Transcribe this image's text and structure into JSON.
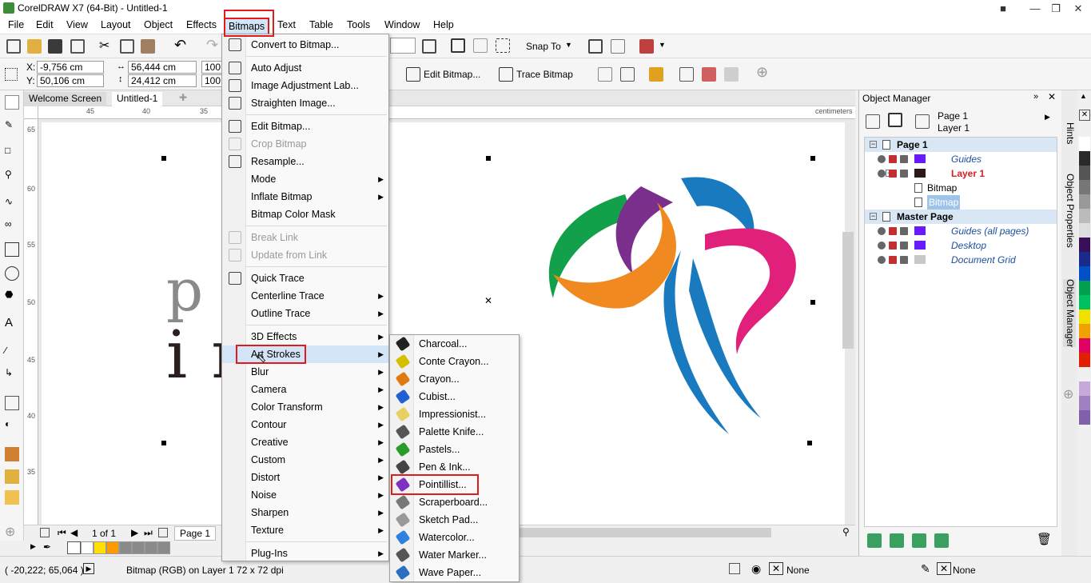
{
  "window": {
    "title": "CorelDRAW X7 (64-Bit) - Untitled-1"
  },
  "menubar": [
    "File",
    "Edit",
    "View",
    "Layout",
    "Object",
    "Effects",
    "Bitmaps",
    "Text",
    "Table",
    "Tools",
    "Window",
    "Help"
  ],
  "toolbar": {
    "snap_to": "Snap To"
  },
  "propbar": {
    "x": "-9,756 cm",
    "y": "50,106 cm",
    "w": "56,444 cm",
    "h": "24,412 cm",
    "sx": "100,",
    "sy": "100,",
    "x_label": "X:",
    "y_label": "Y:",
    "edit_bitmap": "Edit Bitmap...",
    "trace_bitmap": "Trace Bitmap"
  },
  "doc_tabs": [
    "Welcome Screen",
    "Untitled-1"
  ],
  "ruler": {
    "h_ticks": [
      "45",
      "40",
      "35"
    ],
    "unit": "centimeters",
    "v_ticks": [
      "65",
      "60",
      "55",
      "50",
      "45",
      "40",
      "35"
    ]
  },
  "canvas_text": {
    "line1": "p a",
    "line2": "in a"
  },
  "page_nav": {
    "counter": "1 of 1",
    "page_tab": "Page 1"
  },
  "status": {
    "coords": "( -20,222; 65,064 )",
    "info": "Bitmap (RGB) on Layer 1 72 x 72 dpi",
    "fill": "None",
    "outline": "None"
  },
  "bitmaps_menu": [
    {
      "label": "Convert to Bitmap...",
      "icon": "convert-bitmap-icon"
    },
    {
      "sep": true
    },
    {
      "label": "Auto Adjust",
      "icon": "auto-adjust-icon"
    },
    {
      "label": "Image Adjustment Lab...",
      "icon": "adjustment-lab-icon"
    },
    {
      "label": "Straighten Image...",
      "icon": "straighten-icon"
    },
    {
      "sep": true
    },
    {
      "label": "Edit Bitmap...",
      "icon": "edit-bitmap-icon"
    },
    {
      "label": "Crop Bitmap",
      "icon": "crop-icon",
      "disabled": true
    },
    {
      "label": "Resample...",
      "icon": "resample-icon"
    },
    {
      "label": "Mode",
      "submenu": true
    },
    {
      "label": "Inflate Bitmap",
      "submenu": true
    },
    {
      "label": "Bitmap Color Mask"
    },
    {
      "sep": true
    },
    {
      "label": "Break Link",
      "icon": "break-link-icon",
      "disabled": true
    },
    {
      "label": "Update from Link",
      "icon": "update-link-icon",
      "disabled": true
    },
    {
      "sep": true
    },
    {
      "label": "Quick Trace",
      "icon": "quick-trace-icon"
    },
    {
      "label": "Centerline Trace",
      "submenu": true
    },
    {
      "label": "Outline Trace",
      "submenu": true
    },
    {
      "sep": true
    },
    {
      "label": "3D Effects",
      "submenu": true
    },
    {
      "label": "Art Strokes",
      "submenu": true,
      "highlight": true
    },
    {
      "label": "Blur",
      "submenu": true
    },
    {
      "label": "Camera",
      "submenu": true
    },
    {
      "label": "Color Transform",
      "submenu": true
    },
    {
      "label": "Contour",
      "submenu": true
    },
    {
      "label": "Creative",
      "submenu": true
    },
    {
      "label": "Custom",
      "submenu": true
    },
    {
      "label": "Distort",
      "submenu": true
    },
    {
      "label": "Noise",
      "submenu": true
    },
    {
      "label": "Sharpen",
      "submenu": true
    },
    {
      "label": "Texture",
      "submenu": true
    },
    {
      "sep": true
    },
    {
      "label": "Plug-Ins",
      "submenu": true
    }
  ],
  "art_strokes_menu": [
    {
      "label": "Charcoal...",
      "icon": "charcoal-icon",
      "color": "#222222"
    },
    {
      "label": "Conte Crayon...",
      "icon": "conte-crayon-icon",
      "color": "#d4c000"
    },
    {
      "label": "Crayon...",
      "icon": "crayon-icon",
      "color": "#e07a10"
    },
    {
      "label": "Cubist...",
      "icon": "cubist-icon",
      "color": "#2060d0"
    },
    {
      "label": "Impressionist...",
      "icon": "impressionist-icon",
      "color": "#e8d060"
    },
    {
      "label": "Palette Knife...",
      "icon": "palette-knife-icon",
      "color": "#555555"
    },
    {
      "label": "Pastels...",
      "icon": "pastels-icon",
      "color": "#2a9a2a"
    },
    {
      "label": "Pen & Ink...",
      "icon": "pen-ink-icon",
      "color": "#444444"
    },
    {
      "label": "Pointillist...",
      "icon": "pointillist-icon",
      "color": "#8030c0"
    },
    {
      "label": "Scraperboard...",
      "icon": "scraperboard-icon",
      "color": "#777777"
    },
    {
      "label": "Sketch Pad...",
      "icon": "sketch-pad-icon",
      "color": "#999999"
    },
    {
      "label": "Watercolor...",
      "icon": "watercolor-icon",
      "color": "#3080e0"
    },
    {
      "label": "Water Marker...",
      "icon": "water-marker-icon",
      "color": "#555555"
    },
    {
      "label": "Wave Paper...",
      "icon": "wave-paper-icon",
      "color": "#2a70c0"
    }
  ],
  "object_manager": {
    "title": "Object Manager",
    "page_header": [
      "Page 1",
      "Layer 1"
    ],
    "rows": [
      {
        "label": "Page 1",
        "bold": true,
        "hl": true
      },
      {
        "label": "Guides",
        "italic": true,
        "color": "#1d4e9e"
      },
      {
        "label": "Layer 1",
        "bold": true,
        "color": "#d81e1e"
      },
      {
        "label": "Bitmap"
      },
      {
        "label": "Bitmap",
        "selected": true
      },
      {
        "label": "Master Page",
        "bold": true,
        "hl": true
      },
      {
        "label": "Guides (all pages)",
        "italic": true,
        "color": "#1d4e9e"
      },
      {
        "label": "Desktop",
        "italic": true,
        "color": "#1d4e9e"
      },
      {
        "label": "Document Grid",
        "italic": true,
        "color": "#1d4e9e"
      }
    ]
  },
  "side_tabs": [
    "Hints",
    "Object Properties",
    "Object Manager"
  ],
  "palette": [
    "#ffffff",
    "#2a2a2a",
    "#555555",
    "#777777",
    "#999999",
    "#bbbbbb",
    "#dddddd",
    "#3a0f5a",
    "#1a2a8a",
    "#0050c8",
    "#00a050",
    "#00c060",
    "#f0e000",
    "#f0a000",
    "#e00060",
    "#e02000",
    "#f0f0f0",
    "#c8a8d8",
    "#a080c0",
    "#8060a8"
  ],
  "bottom_palette": [
    "#ffffff",
    "#ffe000",
    "#ff9a00",
    "#8a8a8a",
    "#8a8a8a",
    "#8a8a8a",
    "#8a8a8a"
  ]
}
